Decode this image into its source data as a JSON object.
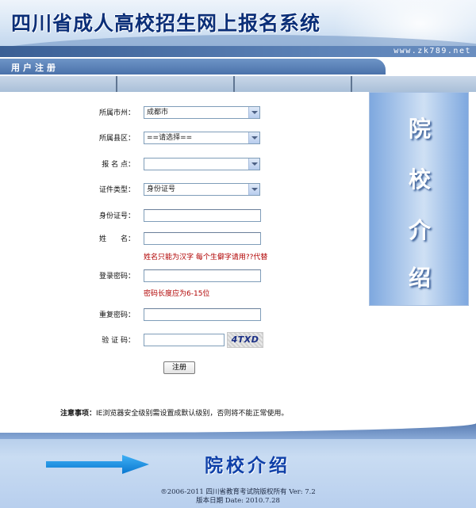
{
  "header": {
    "title": "四川省成人高校招生网上报名系统",
    "url": "www.zk789.net"
  },
  "section": {
    "title": "用户注册"
  },
  "form": {
    "city": {
      "label": "所属市州：",
      "value": "成都市"
    },
    "county": {
      "label": "所属县区：",
      "value": "==请选择=="
    },
    "site": {
      "label": "报 名 点：",
      "value": ""
    },
    "id_type": {
      "label": "证件类型：",
      "value": "身份证号"
    },
    "id_number": {
      "label": "身份证号：",
      "value": ""
    },
    "name": {
      "label": "姓　　名：",
      "value": "",
      "hint": "姓名只能为汉字  每个生僻字请用??代替"
    },
    "password": {
      "label": "登录密码：",
      "value": "",
      "hint": "密码长度应为6-15位"
    },
    "password_repeat": {
      "label": "重复密码：",
      "value": ""
    },
    "captcha": {
      "label": "验 证 码：",
      "value": "",
      "image_text": "4TXD"
    },
    "submit_label": "注册"
  },
  "notice": {
    "label": "注意事项：",
    "text": "IE浏览器安全级别需设置成默认级别，否则将不能正常使用。"
  },
  "sidebar": {
    "chars": [
      "院",
      "校",
      "介",
      "绍"
    ]
  },
  "footer": {
    "slogan": "院校介绍",
    "copyright": "®2006-2011 四川省教育考试院版权所有  Ver: 7.2",
    "date": "版本日期  Date: 2010.7.28"
  },
  "colors": {
    "title_blue": "#0b2f78",
    "hint_red": "#b00000",
    "footer_arrow": "#1a8fe0",
    "footer_slogan": "#0f40a8"
  },
  "icons": {
    "select_arrow": "chevron-down-icon",
    "footer_arrow": "arrow-right-icon"
  }
}
